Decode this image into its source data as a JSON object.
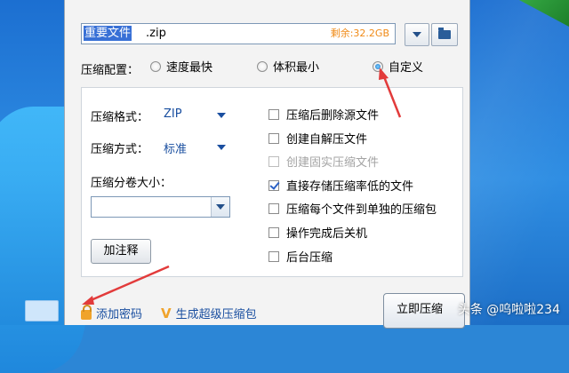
{
  "path": {
    "selected_text": "重要文件",
    "rest_text": ".zip",
    "space_text": "剩余:32.2GB"
  },
  "config": {
    "label": "压缩配置：",
    "options": [
      {
        "label": "速度最快",
        "selected": false
      },
      {
        "label": "体积最小",
        "selected": false
      },
      {
        "label": "自定义",
        "selected": true
      }
    ]
  },
  "options_panel": {
    "format_label": "压缩格式：",
    "format_value": "ZIP",
    "method_label": "压缩方式：",
    "method_value": "标准",
    "volume_label": "压缩分卷大小：",
    "volume_value": "",
    "comment_button": "加注释",
    "checkboxes": [
      {
        "label": "压缩后删除源文件",
        "checked": false,
        "enabled": true
      },
      {
        "label": "创建自解压文件",
        "checked": false,
        "enabled": true
      },
      {
        "label": "创建固实压缩文件",
        "checked": false,
        "enabled": false
      },
      {
        "label": "直接存储压缩率低的文件",
        "checked": true,
        "enabled": true
      },
      {
        "label": "压缩每个文件到单独的压缩包",
        "checked": false,
        "enabled": true
      },
      {
        "label": "操作完成后关机",
        "checked": false,
        "enabled": true
      },
      {
        "label": "后台压缩",
        "checked": false,
        "enabled": true
      }
    ]
  },
  "footer": {
    "add_password": "添加密码",
    "super_archive": "生成超级压缩包",
    "compress_now": "立即压缩"
  },
  "watermark": "头条 @呜啦啦234",
  "colors": {
    "accent": "#1a4fa0",
    "selection": "#3870d6",
    "annotation": "#e23b3b",
    "space": "#f08a16"
  }
}
